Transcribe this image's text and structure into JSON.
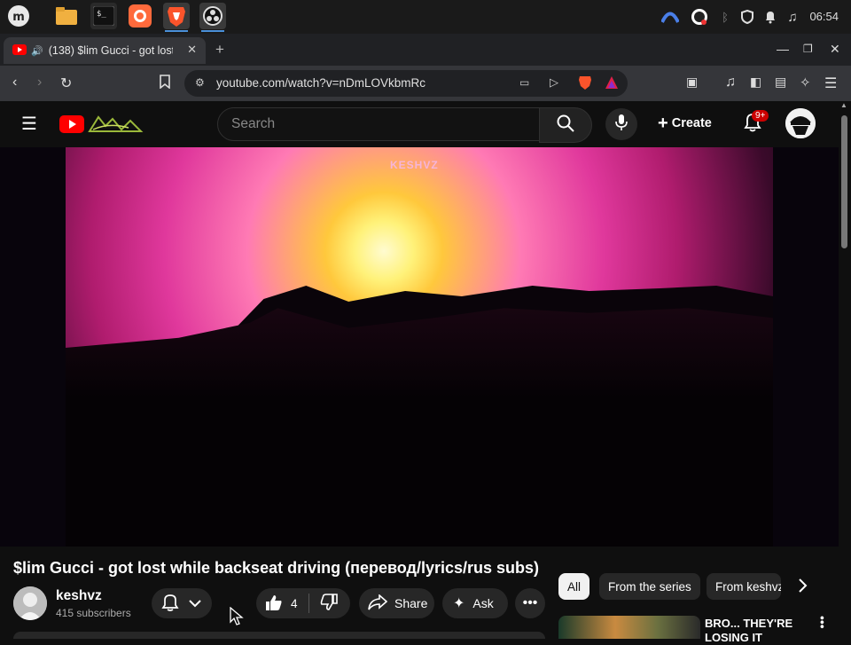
{
  "taskbar": {
    "clock": "06:54"
  },
  "browser": {
    "tab_title": "(138) $lim Gucci - got lost u",
    "url": "youtube.com/watch?v=nDmLOVkbmRc"
  },
  "youtube": {
    "search_placeholder": "Search",
    "create_label": "Create",
    "notif_badge": "9+"
  },
  "video": {
    "watermark": "KESHVZ",
    "title": "$lim Gucci - got lost while backseat driving (перевод/lyrics/rus subs)",
    "channel": "keshvz",
    "subscribers": "415 subscribers",
    "likes": "4",
    "share_label": "Share",
    "ask_label": "Ask"
  },
  "sidebar": {
    "chips": [
      "All",
      "From the series",
      "From keshvz"
    ],
    "rec_title": "BRO... THEY'RE LOSING IT"
  },
  "colors": {
    "accent": "#ff0000",
    "badge": "#cc0000"
  }
}
